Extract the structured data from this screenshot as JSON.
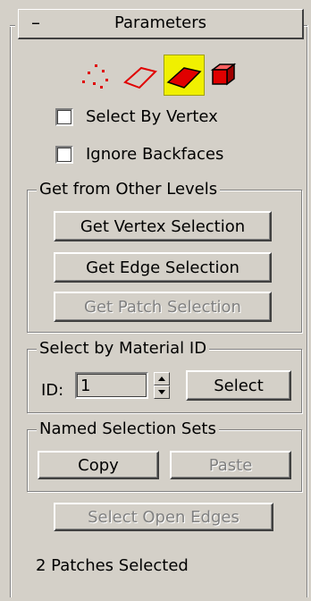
{
  "rollout": {
    "toggle_symbol": "–",
    "title": "Parameters"
  },
  "subobject_icons": [
    {
      "name": "vertex-icon",
      "selected": false
    },
    {
      "name": "edge-icon",
      "selected": false
    },
    {
      "name": "patch-icon",
      "selected": true
    },
    {
      "name": "element-icon",
      "selected": false
    }
  ],
  "checkboxes": {
    "select_by_vertex": {
      "label": "Select By Vertex",
      "checked": false
    },
    "ignore_backfaces": {
      "label": "Ignore Backfaces",
      "checked": false
    }
  },
  "get_from_levels": {
    "title": "Get from Other Levels",
    "vertex_button": "Get Vertex Selection",
    "edge_button": "Get Edge Selection",
    "patch_button": "Get Patch Selection"
  },
  "material_id": {
    "title": "Select by Material ID",
    "id_label": "ID:",
    "id_value": "1",
    "select_button": "Select"
  },
  "named_sets": {
    "title": "Named Selection Sets",
    "copy_button": "Copy",
    "paste_button": "Paste"
  },
  "open_edges_button": "Select Open Edges",
  "status": "2 Patches Selected",
  "colors": {
    "panel": "#d4d0c8",
    "active_icon": "#f0f000",
    "icon_red": "#e00000"
  }
}
